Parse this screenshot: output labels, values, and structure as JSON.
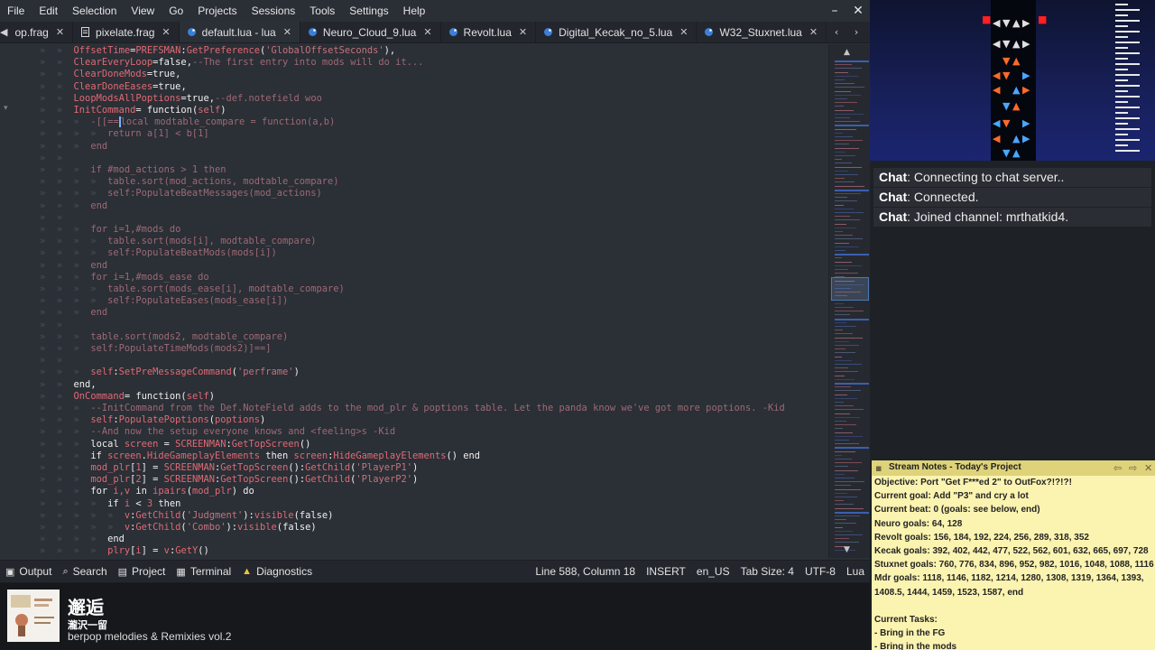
{
  "menubar": {
    "items": [
      "File",
      "Edit",
      "Selection",
      "View",
      "Go",
      "Projects",
      "Sessions",
      "Tools",
      "Settings",
      "Help"
    ],
    "icons": [
      "minimize-icon",
      "close-icon"
    ]
  },
  "tabs": [
    {
      "label": "op.frag",
      "icon": "file-icon",
      "active": false
    },
    {
      "label": "pixelate.frag",
      "icon": "file-icon",
      "active": false
    },
    {
      "label": "default.lua - lua",
      "icon": "lua-file-icon",
      "active": true
    },
    {
      "label": "Neuro_Cloud_9.lua",
      "icon": "lua-file-icon",
      "active": false
    },
    {
      "label": "Revolt.lua",
      "icon": "lua-file-icon",
      "active": false
    },
    {
      "label": "Digital_Kecak_no_5.lua",
      "icon": "lua-file-icon",
      "active": false
    },
    {
      "label": "W32_Stuxnet.lua",
      "icon": "lua-file-icon",
      "active": false
    }
  ],
  "code": [
    {
      "indent": 0,
      "parts": [
        [
          "id",
          "OffsetTime"
        ],
        [
          "kw",
          "="
        ],
        [
          "id",
          "PREFSMAN"
        ],
        [
          "kw",
          ":"
        ],
        [
          "id",
          "GetPreference"
        ],
        [
          "kw",
          "("
        ],
        [
          "str",
          "'GlobalOffsetSeconds'"
        ],
        [
          "kw",
          "),"
        ]
      ]
    },
    {
      "indent": 0,
      "parts": [
        [
          "id",
          "ClearEveryLoop"
        ],
        [
          "kw",
          "="
        ],
        [
          "bool",
          "false"
        ],
        [
          "kw",
          ","
        ],
        [
          "com",
          "--The first entry into mods will do it..."
        ]
      ]
    },
    {
      "indent": 0,
      "parts": [
        [
          "id",
          "ClearDoneMods"
        ],
        [
          "kw",
          "="
        ],
        [
          "bool",
          "true"
        ],
        [
          "kw",
          ","
        ]
      ]
    },
    {
      "indent": 0,
      "parts": [
        [
          "id",
          "ClearDoneEases"
        ],
        [
          "kw",
          "="
        ],
        [
          "bool",
          "true"
        ],
        [
          "kw",
          ","
        ]
      ]
    },
    {
      "indent": 0,
      "parts": [
        [
          "id",
          "LoopModsAllPoptions"
        ],
        [
          "kw",
          "="
        ],
        [
          "bool",
          "true"
        ],
        [
          "kw",
          ","
        ],
        [
          "com",
          "--def.notefield woo"
        ]
      ]
    },
    {
      "indent": 0,
      "parts": [
        [
          "id",
          "InitCommand"
        ],
        [
          "kw",
          "= "
        ],
        [
          "bool",
          "function"
        ],
        [
          "kw",
          "("
        ],
        [
          "id",
          "self"
        ],
        [
          "kw",
          ")"
        ]
      ]
    },
    {
      "indent": 1,
      "cursor": true,
      "parts": [
        [
          "com",
          "-[[=="
        ],
        [
          "cursor",
          ""
        ],
        [
          "com",
          "local modtable_compare = function(a,b)"
        ]
      ]
    },
    {
      "indent": 2,
      "parts": [
        [
          "com",
          "return a[1] < b[1]"
        ]
      ]
    },
    {
      "indent": 1,
      "parts": [
        [
          "com",
          "end"
        ]
      ]
    },
    {
      "indent": 0,
      "parts": []
    },
    {
      "indent": 1,
      "parts": [
        [
          "com",
          "if #mod_actions > 1 then"
        ]
      ]
    },
    {
      "indent": 2,
      "parts": [
        [
          "com",
          "table.sort(mod_actions, modtable_compare)"
        ]
      ]
    },
    {
      "indent": 2,
      "parts": [
        [
          "com",
          "self:PopulateBeatMessages(mod_actions)"
        ]
      ]
    },
    {
      "indent": 1,
      "parts": [
        [
          "com",
          "end"
        ]
      ]
    },
    {
      "indent": 0,
      "parts": []
    },
    {
      "indent": 1,
      "parts": [
        [
          "com",
          "for i=1,#mods do"
        ]
      ]
    },
    {
      "indent": 2,
      "parts": [
        [
          "com",
          "table.sort(mods[i], modtable_compare)"
        ]
      ]
    },
    {
      "indent": 2,
      "parts": [
        [
          "com",
          "self:PopulateBeatMods(mods[i])"
        ]
      ]
    },
    {
      "indent": 1,
      "parts": [
        [
          "com",
          "end"
        ]
      ]
    },
    {
      "indent": 1,
      "parts": [
        [
          "com",
          "for i=1,#mods_ease do"
        ]
      ]
    },
    {
      "indent": 2,
      "parts": [
        [
          "com",
          "table.sort(mods_ease[i], modtable_compare)"
        ]
      ]
    },
    {
      "indent": 2,
      "parts": [
        [
          "com",
          "self:PopulateEases(mods_ease[i])"
        ]
      ]
    },
    {
      "indent": 1,
      "parts": [
        [
          "com",
          "end"
        ]
      ]
    },
    {
      "indent": 0,
      "parts": []
    },
    {
      "indent": 1,
      "parts": [
        [
          "com",
          "table.sort(mods2, modtable_compare)"
        ]
      ]
    },
    {
      "indent": 1,
      "parts": [
        [
          "com",
          "self:PopulateTimeMods(mods2)]==]"
        ]
      ]
    },
    {
      "indent": 0,
      "parts": []
    },
    {
      "indent": 1,
      "parts": [
        [
          "id",
          "self"
        ],
        [
          "kw",
          ":"
        ],
        [
          "id",
          "SetPreMessageCommand"
        ],
        [
          "kw",
          "("
        ],
        [
          "str",
          "'perframe'"
        ],
        [
          "kw",
          ")"
        ]
      ]
    },
    {
      "indent": 0,
      "parts": [
        [
          "bool",
          "end"
        ],
        [
          "kw",
          ","
        ]
      ]
    },
    {
      "indent": 0,
      "parts": [
        [
          "id",
          "OnCommand"
        ],
        [
          "kw",
          "= "
        ],
        [
          "bool",
          "function"
        ],
        [
          "kw",
          "("
        ],
        [
          "id",
          "self"
        ],
        [
          "kw",
          ")"
        ]
      ]
    },
    {
      "indent": 1,
      "parts": [
        [
          "com",
          "--InitCommand from the Def.NoteField adds to the mod_plr & poptions table. Let the panda know we've got more poptions. -Kid"
        ]
      ]
    },
    {
      "indent": 1,
      "parts": [
        [
          "id",
          "self"
        ],
        [
          "kw",
          ":"
        ],
        [
          "id",
          "PopulatePoptions"
        ],
        [
          "kw",
          "("
        ],
        [
          "id",
          "poptions"
        ],
        [
          "kw",
          ")"
        ]
      ]
    },
    {
      "indent": 1,
      "parts": [
        [
          "com",
          "--And now the setup everyone knows and <feeling>s -Kid"
        ]
      ]
    },
    {
      "indent": 1,
      "parts": [
        [
          "bool",
          "local"
        ],
        [
          "id",
          " screen "
        ],
        [
          "kw",
          "= "
        ],
        [
          "id",
          "SCREENMAN"
        ],
        [
          "kw",
          ":"
        ],
        [
          "id",
          "GetTopScreen"
        ],
        [
          "kw",
          "()"
        ]
      ]
    },
    {
      "indent": 1,
      "parts": [
        [
          "bool",
          "if"
        ],
        [
          "id",
          " screen"
        ],
        [
          "kw",
          "."
        ],
        [
          "id",
          "HideGameplayElements "
        ],
        [
          "bool",
          "then"
        ],
        [
          "id",
          " screen"
        ],
        [
          "kw",
          ":"
        ],
        [
          "id",
          "HideGameplayElements"
        ],
        [
          "kw",
          "() "
        ],
        [
          "bool",
          "end"
        ]
      ]
    },
    {
      "indent": 1,
      "parts": [
        [
          "id",
          "mod_plr"
        ],
        [
          "kw",
          "["
        ],
        [
          "id",
          "1"
        ],
        [
          "kw",
          "] = "
        ],
        [
          "id",
          "SCREENMAN"
        ],
        [
          "kw",
          ":"
        ],
        [
          "id",
          "GetTopScreen"
        ],
        [
          "kw",
          "():"
        ],
        [
          "id",
          "GetChild"
        ],
        [
          "kw",
          "("
        ],
        [
          "str",
          "'PlayerP1'"
        ],
        [
          "kw",
          ")"
        ]
      ]
    },
    {
      "indent": 1,
      "parts": [
        [
          "id",
          "mod_plr"
        ],
        [
          "kw",
          "["
        ],
        [
          "id",
          "2"
        ],
        [
          "kw",
          "] = "
        ],
        [
          "id",
          "SCREENMAN"
        ],
        [
          "kw",
          ":"
        ],
        [
          "id",
          "GetTopScreen"
        ],
        [
          "kw",
          "():"
        ],
        [
          "id",
          "GetChild"
        ],
        [
          "kw",
          "("
        ],
        [
          "str",
          "'PlayerP2'"
        ],
        [
          "kw",
          ")"
        ]
      ]
    },
    {
      "indent": 1,
      "parts": [
        [
          "bool",
          "for"
        ],
        [
          "id",
          " i,v "
        ],
        [
          "bool",
          "in"
        ],
        [
          "id",
          " ipairs"
        ],
        [
          "kw",
          "("
        ],
        [
          "id",
          "mod_plr"
        ],
        [
          "kw",
          ") "
        ],
        [
          "bool",
          "do"
        ]
      ]
    },
    {
      "indent": 2,
      "parts": [
        [
          "bool",
          "if"
        ],
        [
          "id",
          " i "
        ],
        [
          "kw",
          "< "
        ],
        [
          "id",
          "3 "
        ],
        [
          "bool",
          "then"
        ]
      ]
    },
    {
      "indent": 3,
      "parts": [
        [
          "id",
          "v"
        ],
        [
          "kw",
          ":"
        ],
        [
          "id",
          "GetChild"
        ],
        [
          "kw",
          "("
        ],
        [
          "str",
          "'Judgment'"
        ],
        [
          "kw",
          "):"
        ],
        [
          "id",
          "visible"
        ],
        [
          "kw",
          "("
        ],
        [
          "bool",
          "false"
        ],
        [
          "kw",
          ")"
        ]
      ]
    },
    {
      "indent": 3,
      "parts": [
        [
          "id",
          "v"
        ],
        [
          "kw",
          ":"
        ],
        [
          "id",
          "GetChild"
        ],
        [
          "kw",
          "("
        ],
        [
          "str",
          "'Combo'"
        ],
        [
          "kw",
          "):"
        ],
        [
          "id",
          "visible"
        ],
        [
          "kw",
          "("
        ],
        [
          "bool",
          "false"
        ],
        [
          "kw",
          ")"
        ]
      ]
    },
    {
      "indent": 2,
      "parts": [
        [
          "bool",
          "end"
        ]
      ]
    },
    {
      "indent": 2,
      "parts": [
        [
          "id",
          "plry"
        ],
        [
          "kw",
          "["
        ],
        [
          "id",
          "i"
        ],
        [
          "kw",
          "] = "
        ],
        [
          "id",
          "v"
        ],
        [
          "kw",
          ":"
        ],
        [
          "id",
          "GetY"
        ],
        [
          "kw",
          "()"
        ]
      ]
    }
  ],
  "statusbar": {
    "output": "Output",
    "search": "Search",
    "project": "Project",
    "terminal": "Terminal",
    "diagnostics": "Diagnostics",
    "position": "Line 588, Column 18",
    "mode": "INSERT",
    "locale": "en_US",
    "tab_size": "Tab Size: 4",
    "encoding": "UTF-8",
    "language": "Lua"
  },
  "now_playing": {
    "title": "邂逅",
    "artist": "瀧沢一留",
    "album": "berpop melodies & Remixies vol.2"
  },
  "chat": [
    {
      "who": "Chat",
      "text": ": Connecting to chat server.."
    },
    {
      "who": "Chat",
      "text": ": Connected."
    },
    {
      "who": "Chat",
      "text": ": Joined channel: mrthatkid4."
    }
  ],
  "notes": {
    "title": "Stream Notes - Today's Project",
    "lines": [
      "Objective: Port \"Get F***ed 2\" to OutFox?!?!?!",
      "Current goal: Add \"P3\" and cry a lot",
      "Current beat: 0 (goals: see below, end)",
      "Neuro goals: 64, 128",
      "Revolt goals: 156, 184, 192, 224, 256, 289, 318, 352",
      "Kecak goals: 392, 402, 442, 477, 522, 562, 601, 632, 665, 697, 728",
      "Stuxnet goals: 760, 776, 834, 896, 952, 982, 1016, 1048, 1088, 1116",
      "Mdr goals: 1118, 1146, 1182, 1214, 1280, 1308, 1319, 1364, 1393,",
      "1408.5, 1444, 1459, 1523, 1587, end",
      "",
      "Current Tasks:",
      "- Bring in the FG",
      "- Bring in the mods"
    ]
  },
  "colors": {
    "editor_bg": "#2b2f36",
    "accent": "#4c78b0",
    "notes_bg": "#fbf3b0",
    "notes_header": "#ded27a"
  }
}
